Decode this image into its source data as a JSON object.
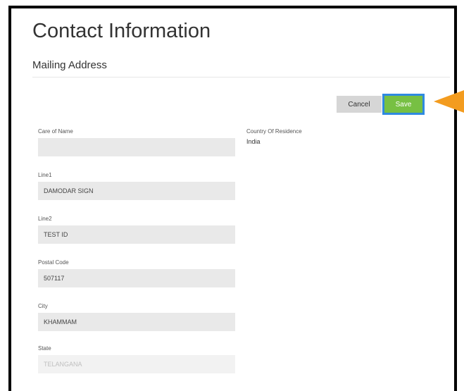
{
  "page": {
    "title": "Contact Information",
    "section": "Mailing Address"
  },
  "actions": {
    "cancel_label": "Cancel",
    "save_label": "Save"
  },
  "form": {
    "care_of_name": {
      "label": "Care of Name",
      "value": ""
    },
    "line1": {
      "label": "Line1",
      "value": "DAMODAR SIGN"
    },
    "line2": {
      "label": "Line2",
      "value": "TEST ID"
    },
    "postal_code": {
      "label": "Postal Code",
      "value": "507117"
    },
    "city": {
      "label": "City",
      "value": "KHAMMAM"
    },
    "state": {
      "label": "State",
      "value": "TELANGANA"
    },
    "country_of_residence": {
      "label": "Country Of Residence",
      "value": "India"
    }
  },
  "colors": {
    "save_button": "#77c043",
    "focus_ring": "#2f8ae0",
    "pointer_arrow": "#f39c1f"
  },
  "icons": {
    "pointer": "orange-arrow-left"
  }
}
